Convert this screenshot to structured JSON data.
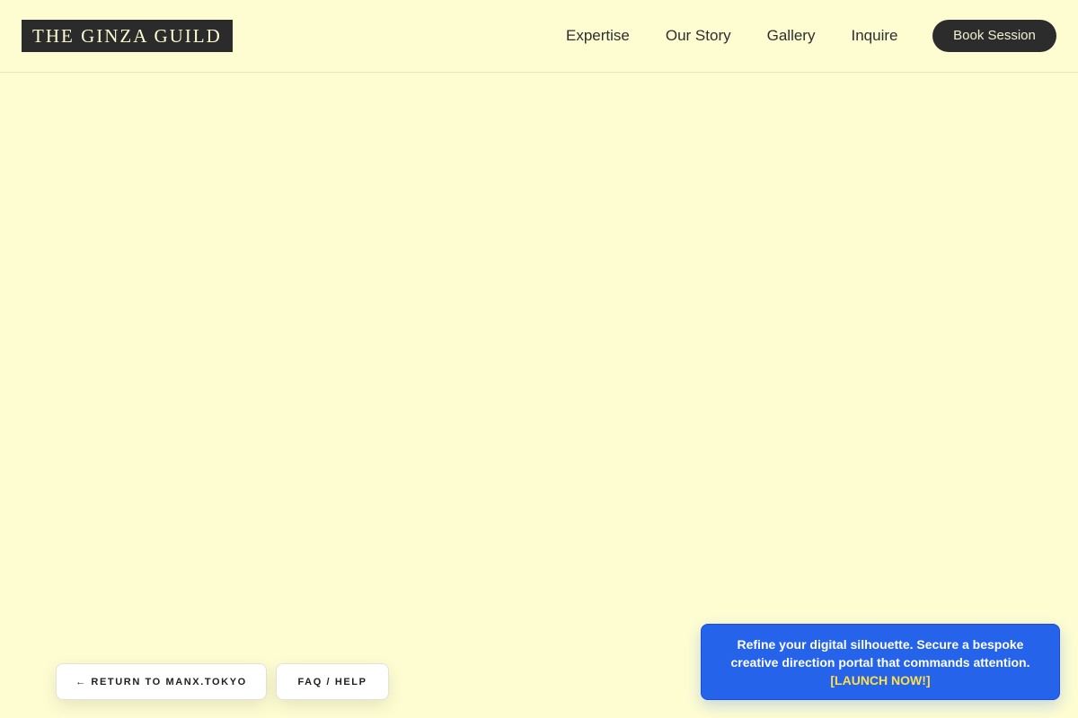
{
  "brand": {
    "name": "THE GINZA GUILD"
  },
  "nav": {
    "items": [
      {
        "label": "Expertise"
      },
      {
        "label": "Our Story"
      },
      {
        "label": "Gallery"
      },
      {
        "label": "Inquire"
      }
    ],
    "cta_label": "Book Session"
  },
  "footer_buttons": {
    "return_label": "← RETURN TO MANX.TOKYO",
    "faq_label": "FAQ / HELP"
  },
  "promo": {
    "text": "Refine your digital silhouette. Secure a bespoke creative direction portal that commands attention.",
    "cta": "[LAUNCH NOW!]"
  },
  "colors": {
    "background": "#fefdd2",
    "dark": "#2b2b2b",
    "promo_blue": "#2563eb",
    "promo_cta": "#fde047"
  }
}
